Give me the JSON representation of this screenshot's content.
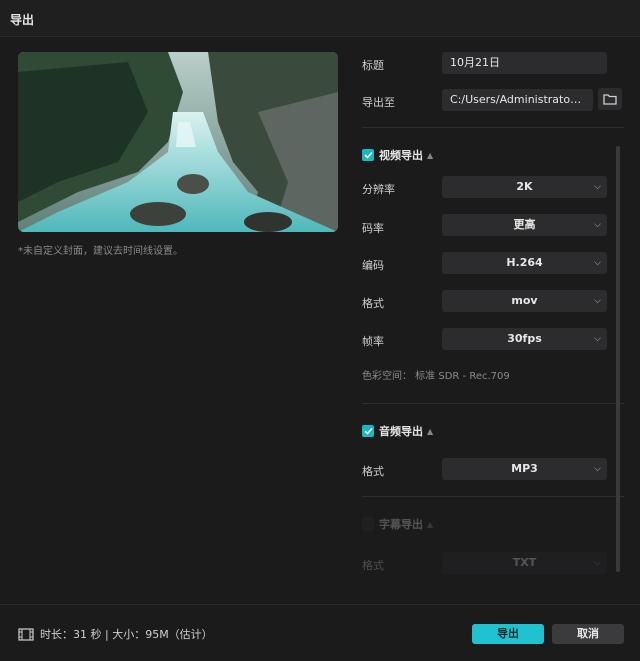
{
  "dialog": {
    "title": "导出"
  },
  "cover": {
    "hint": "*未自定义封面，建议去时间线设置。"
  },
  "form": {
    "title_label": "标题",
    "title_value": "10月21日",
    "export_to_label": "导出至",
    "export_to_value": "C:/Users/Administrator/..."
  },
  "video": {
    "enabled": true,
    "title": "视频导出",
    "fields": [
      {
        "label": "分辨率",
        "value": "2K"
      },
      {
        "label": "码率",
        "value": "更高"
      },
      {
        "label": "编码",
        "value": "H.264"
      },
      {
        "label": "格式",
        "value": "mov"
      },
      {
        "label": "帧率",
        "value": "30fps"
      }
    ],
    "color_space": "色彩空间：  标准 SDR - Rec.709"
  },
  "audio": {
    "enabled": true,
    "title": "音频导出",
    "format_label": "格式",
    "format_value": "MP3"
  },
  "subtitle": {
    "enabled": false,
    "title": "字幕导出",
    "format_label": "格式",
    "format_value": "TXT"
  },
  "footer": {
    "info": "时长：31 秒 | 大小：95M（估计）",
    "export_label": "导出",
    "cancel_label": "取消"
  },
  "colors": {
    "accent": "#20c2cf",
    "background": "#1b1b1c",
    "field": "#2c2c2e"
  },
  "icons": [
    "check-icon",
    "caret-up-icon",
    "chevron-down-icon",
    "folder-icon",
    "film-icon"
  ]
}
